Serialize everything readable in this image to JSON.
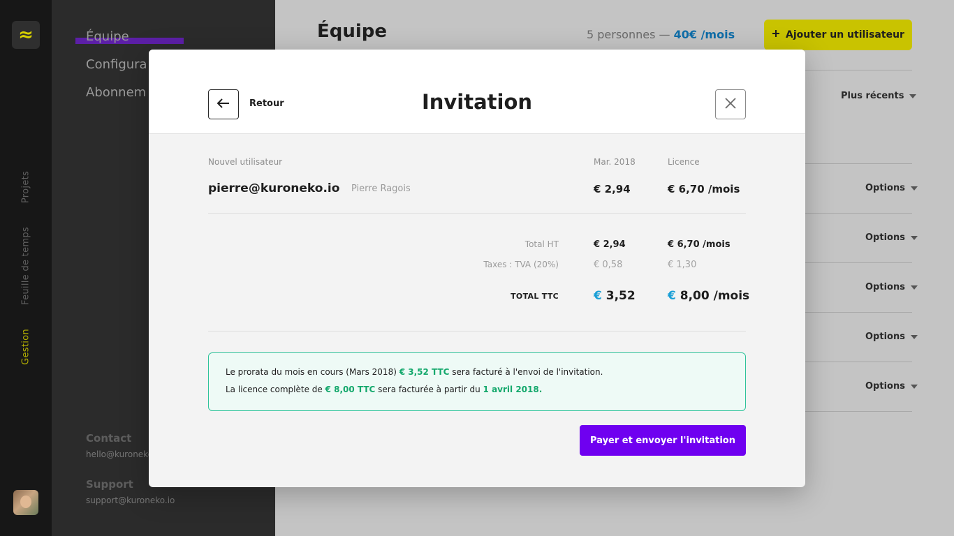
{
  "rail": {
    "logo_glyph": "≈",
    "items": [
      {
        "label": "Projets"
      },
      {
        "label": "Feuille de temps"
      },
      {
        "label": "Gestion"
      }
    ],
    "avatar_icon": "user-avatar"
  },
  "sidebar": {
    "items": [
      {
        "label": "Équipe"
      },
      {
        "label": "Configura"
      },
      {
        "label": "Abonnem"
      }
    ],
    "contact_label": "Contact",
    "contact_email": "hello@kuroneko",
    "support_label": "Support",
    "support_email": "support@kuroneko.io"
  },
  "main": {
    "title": "Équipe",
    "summary_count": "5 personnes — ",
    "summary_price": "40€ /mois",
    "add_user_label": "Ajouter un utilisateur",
    "sort_label": "Plus récents",
    "options_label": "Options"
  },
  "modal": {
    "back_label": "Retour",
    "title": "Invitation",
    "columns": {
      "user": "Nouvel utilisateur",
      "month": "Mar. 2018",
      "licence": "Licence"
    },
    "user_email": "pierre@kuroneko.io",
    "user_name": "Pierre Ragois",
    "user_month_price": "€ 2,94",
    "user_licence_price": "€ 6,70 /mois",
    "totals": {
      "ht_label": "Total HT",
      "ht_month": "€ 2,94",
      "ht_licence": "€ 6,70 /mois",
      "tax_label": "Taxes : TVA (20%)",
      "tax_month": "€ 0,58",
      "tax_licence": "€ 1,30",
      "ttc_label": "TOTAL TTC",
      "ttc_month_symbol": "€",
      "ttc_month": " 3,52",
      "ttc_licence_symbol": "€",
      "ttc_licence": " 8,00 /mois"
    },
    "info": {
      "line1_a": "Le prorata du mois en cours (Mars 2018) ",
      "line1_hl": "€ 3,52 TTC",
      "line1_b": " sera facturé à l'envoi de l'invitation.",
      "line2_a": "La licence complète de ",
      "line2_hl": "€ 8,00 TTC",
      "line2_b": " sera facturée à partir du ",
      "line2_hl2": "1 avril 2018."
    },
    "pay_label": "Payer et envoyer l'invitation"
  },
  "colors": {
    "accent_yellow": "#c9c300",
    "accent_purple": "#6f00f0",
    "accent_blue": "#1a9fd6",
    "accent_green": "#14a86c"
  }
}
